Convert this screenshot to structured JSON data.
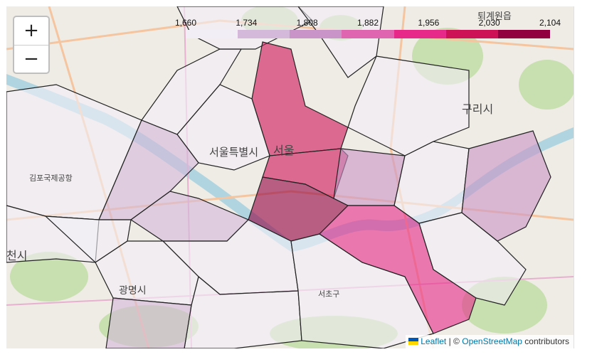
{
  "map": {
    "district_labels": [
      {
        "name": "서울특별시"
      },
      {
        "name": "서울"
      },
      {
        "name": "구리시"
      },
      {
        "name": "김포국제공항"
      },
      {
        "name": "광명시"
      },
      {
        "name": "천시"
      },
      {
        "name": "서초구"
      },
      {
        "name": "퇴계원읍"
      }
    ],
    "zones": [
      {
        "id": "northwest",
        "value": 1660
      },
      {
        "id": "north-a",
        "value": 1670
      },
      {
        "id": "north-b",
        "value": 1665
      },
      {
        "id": "northeast-a",
        "value": 1680
      },
      {
        "id": "northeast-b",
        "value": 1690
      },
      {
        "id": "jongno",
        "value": 1985
      },
      {
        "id": "seodaemun",
        "value": 1700
      },
      {
        "id": "mapo",
        "value": 1745
      },
      {
        "id": "junggu",
        "value": 2020
      },
      {
        "id": "yongsan",
        "value": 2100
      },
      {
        "id": "seongdong",
        "value": 1790
      },
      {
        "id": "gwangjin",
        "value": 1675
      },
      {
        "id": "gangdong",
        "value": 1800
      },
      {
        "id": "gangseo-a",
        "value": 1662
      },
      {
        "id": "gangseo-b",
        "value": 1668
      },
      {
        "id": "yeongdeungpo",
        "value": 1760
      },
      {
        "id": "dongjak",
        "value": 1685
      },
      {
        "id": "gwanak",
        "value": 1700
      },
      {
        "id": "guro",
        "value": 1672
      },
      {
        "id": "geumcheon",
        "value": 1730
      },
      {
        "id": "seocho",
        "value": 1720
      },
      {
        "id": "gangnam",
        "value": 1940
      },
      {
        "id": "songpa",
        "value": 1698
      }
    ]
  },
  "legend": {
    "ticks": [
      "1,660",
      "1,734",
      "1,808",
      "1,882",
      "1,956",
      "2,030",
      "2,104"
    ],
    "colors": [
      "#f1eef6",
      "#d4b9da",
      "#c994c7",
      "#df65b0",
      "#e7298a",
      "#ce1256",
      "#91003f"
    ],
    "min": 1660,
    "max": 2104
  },
  "zoom": {
    "in_label": "+",
    "out_label": "−"
  },
  "attribution": {
    "leaflet": "Leaflet",
    "separator": "| ©",
    "osm": "OpenStreetMap",
    "suffix": "contributors"
  }
}
